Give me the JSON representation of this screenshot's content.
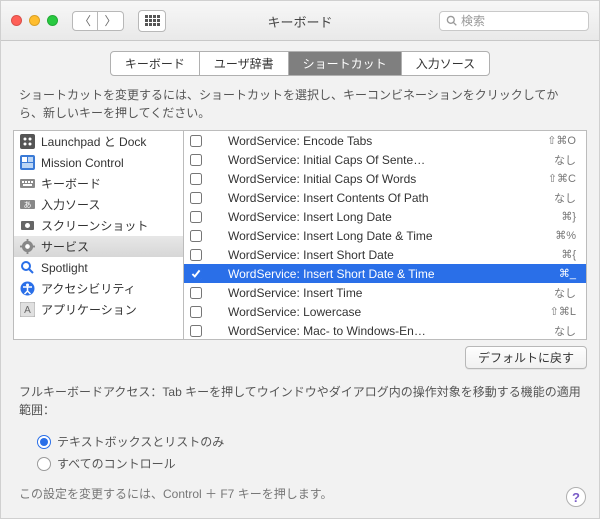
{
  "window": {
    "title": "キーボード",
    "search_placeholder": "検索"
  },
  "tabs": [
    {
      "label": "キーボード",
      "active": false
    },
    {
      "label": "ユーザ辞書",
      "active": false
    },
    {
      "label": "ショートカット",
      "active": true
    },
    {
      "label": "入力ソース",
      "active": false
    }
  ],
  "instruction": "ショートカットを変更するには、ショートカットを選択し、キーコンビネーションをクリックしてから、新しいキーを押してください。",
  "sidebar": {
    "items": [
      {
        "label": "Launchpad と Dock",
        "icon": "launchpad",
        "selected": false
      },
      {
        "label": "Mission Control",
        "icon": "mission",
        "selected": false
      },
      {
        "label": "キーボード",
        "icon": "keyboard",
        "selected": false
      },
      {
        "label": "入力ソース",
        "icon": "input",
        "selected": false
      },
      {
        "label": "スクリーンショット",
        "icon": "screenshot",
        "selected": false
      },
      {
        "label": "サービス",
        "icon": "gear",
        "selected": true
      },
      {
        "label": "Spotlight",
        "icon": "spotlight",
        "selected": false
      },
      {
        "label": "アクセシビリティ",
        "icon": "accessibility",
        "selected": false
      },
      {
        "label": "アプリケーション",
        "icon": "app",
        "selected": false
      }
    ]
  },
  "shortcuts": {
    "items": [
      {
        "checked": false,
        "label": "WordService: Encode Tabs",
        "shortcut": "⇧⌘O",
        "selected": false
      },
      {
        "checked": false,
        "label": "WordService: Initial Caps Of Sente…",
        "shortcut": "なし",
        "selected": false
      },
      {
        "checked": false,
        "label": "WordService: Initial Caps Of Words",
        "shortcut": "⇧⌘C",
        "selected": false
      },
      {
        "checked": false,
        "label": "WordService: Insert Contents Of Path",
        "shortcut": "なし",
        "selected": false
      },
      {
        "checked": false,
        "label": "WordService: Insert Long Date",
        "shortcut": "⌘}",
        "selected": false
      },
      {
        "checked": false,
        "label": "WordService: Insert Long Date & Time",
        "shortcut": "⌘%",
        "selected": false
      },
      {
        "checked": false,
        "label": "WordService: Insert Short Date",
        "shortcut": "⌘{",
        "selected": false
      },
      {
        "checked": true,
        "label": "WordService: Insert Short Date & Time",
        "shortcut": "⌘_",
        "selected": true
      },
      {
        "checked": false,
        "label": "WordService: Insert Time",
        "shortcut": "なし",
        "selected": false
      },
      {
        "checked": false,
        "label": "WordService: Lowercase",
        "shortcut": "⇧⌘L",
        "selected": false
      },
      {
        "checked": false,
        "label": "WordService: Mac- to Windows-En…",
        "shortcut": "なし",
        "selected": false
      }
    ]
  },
  "buttons": {
    "restore_defaults": "デフォルトに戻す"
  },
  "fka": {
    "desc": "フルキーボードアクセス：Tab キーを押してウインドウやダイアログ内の操作対象を移動する機能の適用範囲：",
    "options": [
      {
        "label": "テキストボックスとリストのみ",
        "selected": true
      },
      {
        "label": "すべてのコントロール",
        "selected": false
      }
    ],
    "hint": "この設定を変更するには、Control ＋ F7 キーを押します。"
  }
}
